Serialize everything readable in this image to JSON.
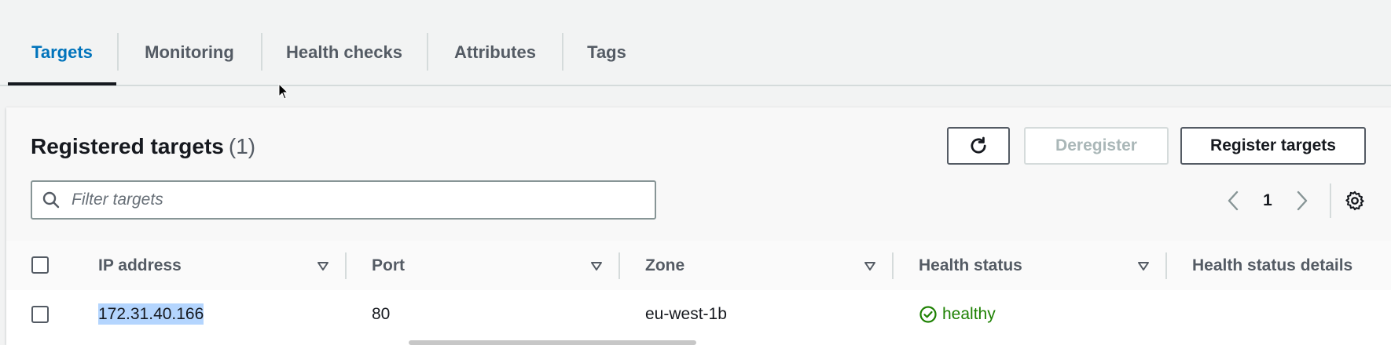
{
  "tabs": [
    {
      "label": "Targets",
      "active": true
    },
    {
      "label": "Monitoring",
      "active": false
    },
    {
      "label": "Health checks",
      "active": false
    },
    {
      "label": "Attributes",
      "active": false
    },
    {
      "label": "Tags",
      "active": false
    }
  ],
  "panel": {
    "title": "Registered targets",
    "count": "(1)",
    "buttons": {
      "refresh_icon": "refresh-icon",
      "deregister": "Deregister",
      "register": "Register targets"
    },
    "search": {
      "placeholder": "Filter targets",
      "value": ""
    },
    "pagination": {
      "current_page": "1"
    }
  },
  "table": {
    "columns": [
      "IP address",
      "Port",
      "Zone",
      "Health status",
      "Health status details"
    ],
    "rows": [
      {
        "ip": "172.31.40.166",
        "port": "80",
        "zone": "eu-west-1b",
        "health_status": "healthy",
        "health_details": ""
      }
    ]
  },
  "colors": {
    "accent": "#0073bb",
    "healthy": "#1d8102",
    "selection": "#b4d5fe"
  }
}
